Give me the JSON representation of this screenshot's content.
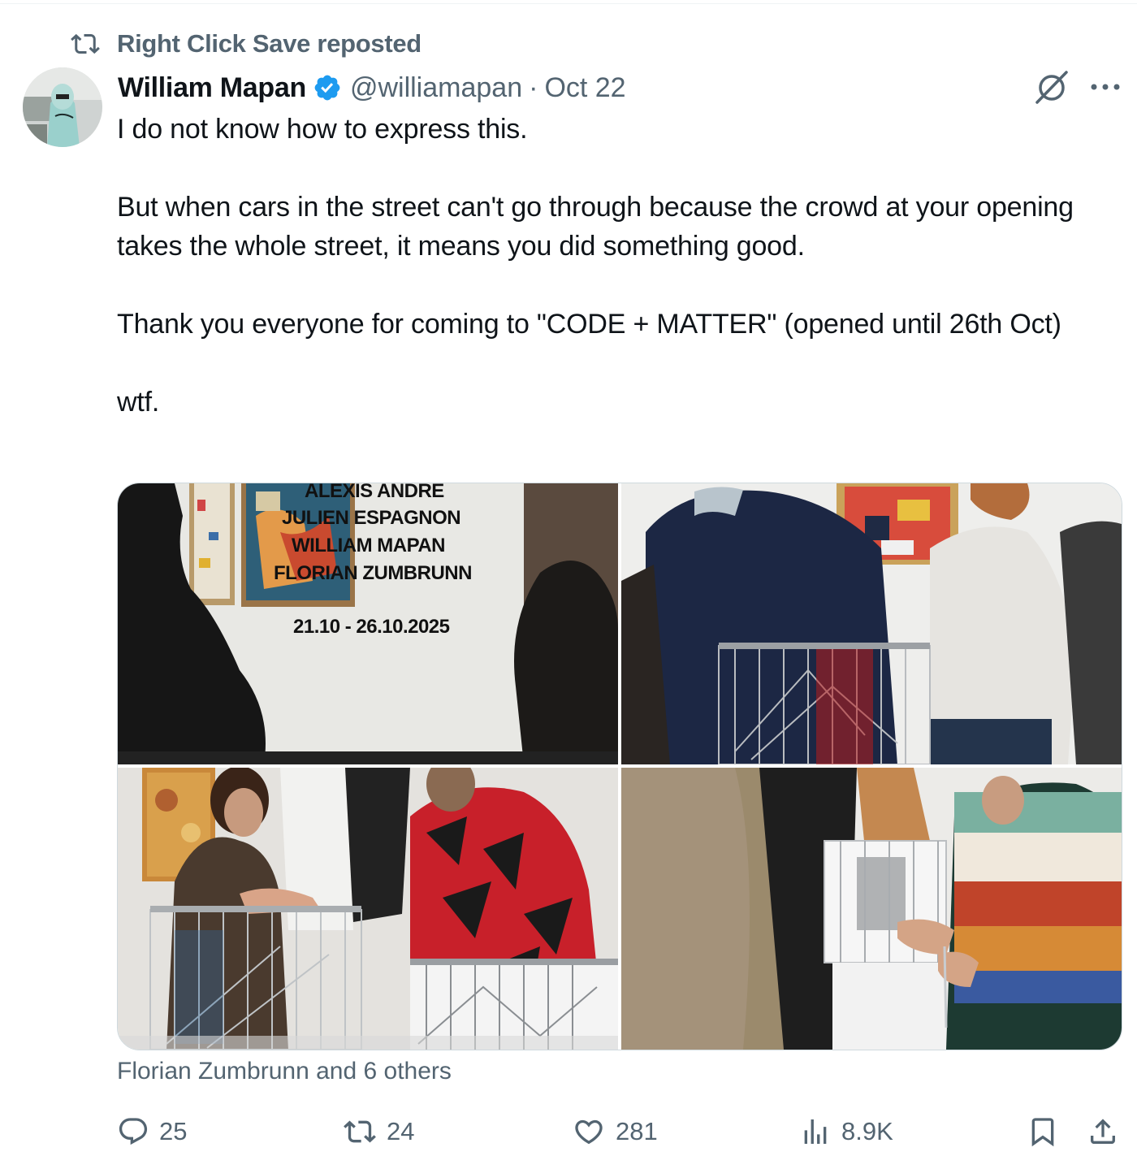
{
  "repost": {
    "label": "Right Click Save reposted",
    "icon": "repost-icon"
  },
  "author": {
    "name": "William Mapan",
    "handle": "@williamapan",
    "separator": "·",
    "date": "Oct 22",
    "verified": true
  },
  "tweet": {
    "paragraphs": [
      "I do not know how to express this.",
      "But when cars in the street can't go through because the crowd at your opening takes the whole street, it means you did something good.",
      "Thank you everyone for coming to \"CODE + MATTER\" (opened until 26th Oct)",
      "wtf."
    ]
  },
  "media": {
    "poster_lines": [
      "ALEXIS ANDRE",
      "JULIEN ESPAGNON",
      "WILLIAM MAPAN",
      "FLORIAN ZUMBRUNN"
    ],
    "poster_dates": "21.10 - 26.10.2025"
  },
  "tagged": "Florian Zumbrunn and 6 others",
  "actions": {
    "replies": "25",
    "reposts": "24",
    "likes": "281",
    "views": "8.9K"
  },
  "colors": {
    "text": "#0f1419",
    "secondary": "#536471",
    "verified": "#1d9bf0",
    "border": "#cfd9de"
  }
}
